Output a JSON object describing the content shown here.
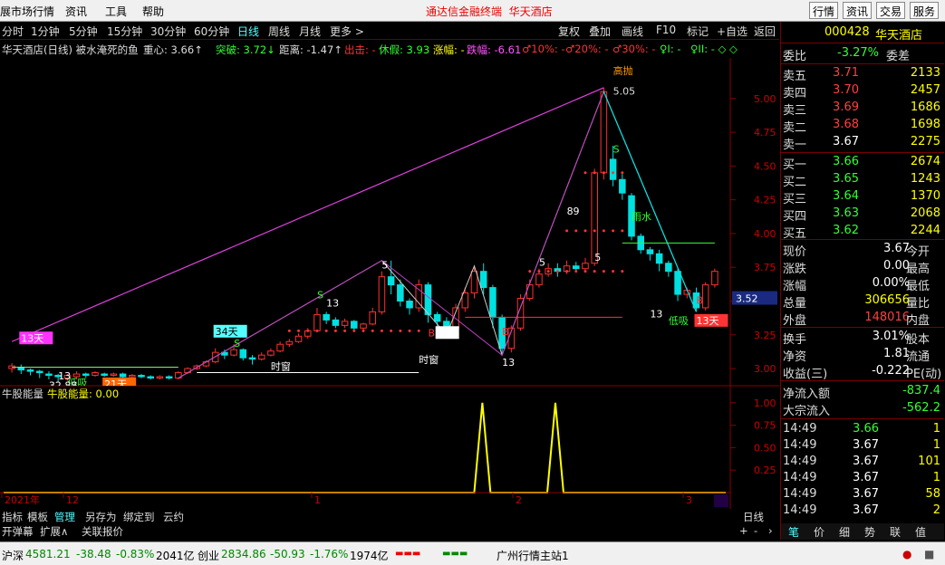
{
  "menu": {
    "items": [
      "展市场行情",
      "资讯",
      "工具",
      "帮助"
    ],
    "title": "通达信金融终端",
    "title_stock": "华天酒店",
    "right_buttons": [
      "行情",
      "资讯",
      "交易",
      "服务"
    ]
  },
  "toolbar": {
    "periods": [
      "分时",
      "1分钟",
      "5分钟",
      "15分钟",
      "30分钟",
      "60分钟",
      "日线",
      "周线",
      "月线",
      "更多 >"
    ],
    "active": "日线",
    "right": [
      "复权",
      "叠加",
      "画线",
      "F10",
      "标记",
      "+自选",
      "返回"
    ]
  },
  "info": {
    "name": "华天酒店(日线) 被水淹死的鱼",
    "center": "重心: 3.66↑",
    "breakout": "突破: 3.72↓",
    "distance": "距离: -1.47↑",
    "exit": "出击: -",
    "rest": "休假: 3.93",
    "rise": "涨幅: -",
    "fall": "跌幅: -6.61",
    "p10": "♂10%: -",
    "p20": "♂20%: -",
    "p30": "♂30%: -",
    "q1": "♀I: -",
    "q2": "♀II: - ◇ ◇"
  },
  "chart_data": {
    "type": "candlestick",
    "ylim": [
      2.9,
      5.3
    ],
    "y_ticks": [
      "5.00",
      "4.75",
      "4.50",
      "4.25",
      "4.00",
      "3.75",
      "3.50",
      "3.25",
      "3.00"
    ],
    "current_price_label": "3.52",
    "high_label": "5.05",
    "annotations": [
      "高抛",
      "13天",
      "34天",
      "21天",
      "低吸",
      "雨水",
      "时窗",
      "时窗",
      "低吸",
      "89",
      "13",
      "13",
      "13",
      "13",
      "13",
      "5",
      "5",
      "5",
      "S",
      "S",
      "S",
      "B",
      "B",
      "B",
      "13天",
      "32.88",
      "用到未来数据",
      "减",
      "榜",
      "跌"
    ],
    "candles": [
      {
        "o": 3.0,
        "c": 3.02,
        "h": 3.04,
        "l": 2.97
      },
      {
        "o": 3.01,
        "c": 2.99,
        "h": 3.03,
        "l": 2.96
      },
      {
        "o": 2.99,
        "c": 2.98,
        "h": 3.0,
        "l": 2.95
      },
      {
        "o": 2.98,
        "c": 2.97,
        "h": 2.99,
        "l": 2.93
      },
      {
        "o": 2.96,
        "c": 2.95,
        "h": 2.98,
        "l": 2.92
      },
      {
        "o": 2.95,
        "c": 2.94,
        "h": 2.96,
        "l": 2.9
      },
      {
        "o": 2.93,
        "c": 2.95,
        "h": 2.96,
        "l": 2.91
      },
      {
        "o": 2.94,
        "c": 2.96,
        "h": 2.98,
        "l": 2.92
      },
      {
        "o": 2.96,
        "c": 2.95,
        "h": 2.97,
        "l": 2.93
      },
      {
        "o": 2.95,
        "c": 2.97,
        "h": 2.98,
        "l": 2.94
      },
      {
        "o": 2.96,
        "c": 2.95,
        "h": 2.97,
        "l": 2.94
      },
      {
        "o": 2.95,
        "c": 2.96,
        "h": 2.97,
        "l": 2.94
      },
      {
        "o": 2.96,
        "c": 2.94,
        "h": 2.97,
        "l": 2.93
      },
      {
        "o": 2.94,
        "c": 2.95,
        "h": 2.96,
        "l": 2.93
      },
      {
        "o": 2.95,
        "c": 2.94,
        "h": 2.96,
        "l": 2.93
      },
      {
        "o": 2.94,
        "c": 2.93,
        "h": 2.95,
        "l": 2.92
      },
      {
        "o": 2.93,
        "c": 2.94,
        "h": 2.95,
        "l": 2.92
      },
      {
        "o": 2.94,
        "c": 2.93,
        "h": 2.95,
        "l": 2.92
      },
      {
        "o": 2.93,
        "c": 2.97,
        "h": 2.98,
        "l": 2.92
      },
      {
        "o": 2.97,
        "c": 3.0,
        "h": 3.01,
        "l": 2.96
      },
      {
        "o": 3.0,
        "c": 3.02,
        "h": 3.03,
        "l": 2.99
      },
      {
        "o": 3.02,
        "c": 3.05,
        "h": 3.06,
        "l": 3.01
      },
      {
        "o": 3.05,
        "c": 3.12,
        "h": 3.15,
        "l": 3.04
      },
      {
        "o": 3.12,
        "c": 3.1,
        "h": 3.14,
        "l": 3.07
      },
      {
        "o": 3.1,
        "c": 3.14,
        "h": 3.18,
        "l": 3.09
      },
      {
        "o": 3.14,
        "c": 3.08,
        "h": 3.15,
        "l": 3.06
      },
      {
        "o": 3.08,
        "c": 3.07,
        "h": 3.1,
        "l": 3.03
      },
      {
        "o": 3.07,
        "c": 3.1,
        "h": 3.12,
        "l": 3.06
      },
      {
        "o": 3.1,
        "c": 3.13,
        "h": 3.15,
        "l": 3.09
      },
      {
        "o": 3.13,
        "c": 3.18,
        "h": 3.2,
        "l": 3.12
      },
      {
        "o": 3.18,
        "c": 3.2,
        "h": 3.22,
        "l": 3.16
      },
      {
        "o": 3.2,
        "c": 3.24,
        "h": 3.26,
        "l": 3.19
      },
      {
        "o": 3.24,
        "c": 3.28,
        "h": 3.3,
        "l": 3.22
      },
      {
        "o": 3.28,
        "c": 3.4,
        "h": 3.45,
        "l": 3.27
      },
      {
        "o": 3.4,
        "c": 3.36,
        "h": 3.42,
        "l": 3.33
      },
      {
        "o": 3.36,
        "c": 3.32,
        "h": 3.38,
        "l": 3.3
      },
      {
        "o": 3.32,
        "c": 3.35,
        "h": 3.37,
        "l": 3.3
      },
      {
        "o": 3.35,
        "c": 3.3,
        "h": 3.36,
        "l": 3.28
      },
      {
        "o": 3.3,
        "c": 3.33,
        "h": 3.34,
        "l": 3.28
      },
      {
        "o": 3.33,
        "c": 3.42,
        "h": 3.45,
        "l": 3.32
      },
      {
        "o": 3.42,
        "c": 3.68,
        "h": 3.72,
        "l": 3.4
      },
      {
        "o": 3.68,
        "c": 3.62,
        "h": 3.8,
        "l": 3.55
      },
      {
        "o": 3.62,
        "c": 3.5,
        "h": 3.66,
        "l": 3.46
      },
      {
        "o": 3.5,
        "c": 3.45,
        "h": 3.52,
        "l": 3.4
      },
      {
        "o": 3.45,
        "c": 3.62,
        "h": 3.66,
        "l": 3.42
      },
      {
        "o": 3.62,
        "c": 3.4,
        "h": 3.64,
        "l": 3.34
      },
      {
        "o": 3.4,
        "c": 3.35,
        "h": 3.42,
        "l": 3.3
      },
      {
        "o": 3.35,
        "c": 3.3,
        "h": 3.38,
        "l": 3.25
      },
      {
        "o": 3.3,
        "c": 3.45,
        "h": 3.48,
        "l": 3.28
      },
      {
        "o": 3.45,
        "c": 3.56,
        "h": 3.6,
        "l": 3.42
      },
      {
        "o": 3.56,
        "c": 3.72,
        "h": 3.76,
        "l": 3.52
      },
      {
        "o": 3.72,
        "c": 3.6,
        "h": 3.78,
        "l": 3.55
      },
      {
        "o": 3.6,
        "c": 3.38,
        "h": 3.62,
        "l": 3.3
      },
      {
        "o": 3.38,
        "c": 3.15,
        "h": 3.4,
        "l": 3.1
      },
      {
        "o": 3.15,
        "c": 3.3,
        "h": 3.32,
        "l": 3.12
      },
      {
        "o": 3.3,
        "c": 3.52,
        "h": 3.55,
        "l": 3.28
      },
      {
        "o": 3.52,
        "c": 3.62,
        "h": 3.66,
        "l": 3.5
      },
      {
        "o": 3.62,
        "c": 3.7,
        "h": 3.74,
        "l": 3.6
      },
      {
        "o": 3.7,
        "c": 3.74,
        "h": 3.78,
        "l": 3.68
      },
      {
        "o": 3.74,
        "c": 3.72,
        "h": 3.78,
        "l": 3.68
      },
      {
        "o": 3.72,
        "c": 3.76,
        "h": 3.8,
        "l": 3.7
      },
      {
        "o": 3.76,
        "c": 3.74,
        "h": 3.79,
        "l": 3.72
      },
      {
        "o": 3.74,
        "c": 3.78,
        "h": 3.82,
        "l": 3.72
      },
      {
        "o": 3.78,
        "c": 4.45,
        "h": 4.48,
        "l": 3.76
      },
      {
        "o": 4.45,
        "c": 5.05,
        "h": 5.08,
        "l": 4.4
      },
      {
        "o": 4.55,
        "c": 4.4,
        "h": 4.65,
        "l": 4.35
      },
      {
        "o": 4.4,
        "c": 4.3,
        "h": 4.44,
        "l": 4.25
      },
      {
        "o": 4.28,
        "c": 3.98,
        "h": 4.3,
        "l": 3.95
      },
      {
        "o": 3.98,
        "c": 3.88,
        "h": 4.0,
        "l": 3.85
      },
      {
        "o": 3.88,
        "c": 3.85,
        "h": 3.9,
        "l": 3.8
      },
      {
        "o": 3.85,
        "c": 3.78,
        "h": 3.88,
        "l": 3.72
      },
      {
        "o": 3.78,
        "c": 3.72,
        "h": 3.8,
        "l": 3.68
      },
      {
        "o": 3.72,
        "c": 3.55,
        "h": 3.74,
        "l": 3.5
      },
      {
        "o": 3.55,
        "c": 3.58,
        "h": 3.6,
        "l": 3.52
      },
      {
        "o": 3.56,
        "c": 3.45,
        "h": 3.6,
        "l": 3.42
      },
      {
        "o": 3.45,
        "c": 3.62,
        "h": 3.64,
        "l": 3.43
      },
      {
        "o": 3.62,
        "c": 3.72,
        "h": 3.74,
        "l": 3.6
      }
    ],
    "sub": {
      "title": "牛股能量",
      "value_label": "牛股能量: 0.00",
      "y_ticks": [
        "1.00",
        "0.75",
        "0.50",
        "0.25"
      ],
      "ylim": [
        0,
        1.15
      ],
      "values": [
        0,
        0,
        0,
        0,
        0,
        0,
        0,
        0,
        0,
        0,
        0,
        0,
        0,
        0,
        0,
        0,
        0,
        0,
        0,
        0,
        0,
        0,
        0,
        0,
        0,
        0,
        0,
        0,
        0,
        0,
        0,
        0,
        0,
        0,
        0,
        0,
        0,
        0,
        0,
        0,
        0,
        0,
        0,
        0,
        0,
        0,
        0,
        0,
        0,
        0,
        0,
        0,
        0,
        0,
        0,
        0,
        0,
        0,
        0,
        1,
        0,
        0,
        0,
        0,
        0,
        0,
        0,
        0,
        1,
        0,
        0,
        0,
        0,
        0,
        0,
        0,
        0,
        0,
        0,
        0,
        0,
        0,
        0,
        0,
        0,
        0,
        0,
        0,
        0,
        0
      ]
    },
    "time_axis": [
      "2021年",
      "12",
      "1",
      "2",
      "3"
    ]
  },
  "quote": {
    "code": "000428",
    "name": "华天酒店",
    "ratio_label": "委比",
    "ratio_value": "-3.27%",
    "diff_label": "委差",
    "asks": [
      {
        "label": "卖五",
        "price": "3.71",
        "vol": "2133"
      },
      {
        "label": "卖四",
        "price": "3.70",
        "vol": "2457"
      },
      {
        "label": "卖三",
        "price": "3.69",
        "vol": "1686"
      },
      {
        "label": "卖二",
        "price": "3.68",
        "vol": "1698"
      },
      {
        "label": "卖一",
        "price": "3.67",
        "vol": "2275"
      }
    ],
    "bids": [
      {
        "label": "买一",
        "price": "3.66",
        "vol": "2674"
      },
      {
        "label": "买二",
        "price": "3.65",
        "vol": "1243"
      },
      {
        "label": "买三",
        "price": "3.64",
        "vol": "1370"
      },
      {
        "label": "买四",
        "price": "3.63",
        "vol": "2068"
      },
      {
        "label": "买五",
        "price": "3.62",
        "vol": "2244"
      }
    ],
    "stats": [
      {
        "l": "现价",
        "v": "3.67",
        "r": "今开",
        "c": "wht"
      },
      {
        "l": "涨跌",
        "v": "0.00",
        "r": "最高",
        "c": "wht"
      },
      {
        "l": "涨幅",
        "v": "0.00%",
        "r": "最低",
        "c": "wht"
      },
      {
        "l": "总量",
        "v": "306656",
        "r": "量比",
        "c": "yel"
      },
      {
        "l": "外盘",
        "v": "148016",
        "r": "内盘",
        "c": "red"
      }
    ],
    "stats2": [
      {
        "l": "换手",
        "v": "3.01%",
        "r": "股本",
        "c": "wht"
      },
      {
        "l": "净资",
        "v": "1.81",
        "r": "流通",
        "c": "wht"
      },
      {
        "l": "收益(三)",
        "v": "-0.222",
        "r": "PE(动)",
        "c": "wht"
      }
    ],
    "flow": [
      {
        "l": "净流入额",
        "v": "-837.4"
      },
      {
        "l": "大宗流入",
        "v": "-562.2"
      }
    ],
    "ticks": [
      {
        "t": "14:49",
        "p": "3.66",
        "v": "1",
        "pc": "grn"
      },
      {
        "t": "14:49",
        "p": "3.67",
        "v": "1",
        "pc": "wht"
      },
      {
        "t": "14:49",
        "p": "3.67",
        "v": "101",
        "pc": "wht"
      },
      {
        "t": "14:49",
        "p": "3.67",
        "v": "1",
        "pc": "wht"
      },
      {
        "t": "14:49",
        "p": "3.67",
        "v": "58",
        "pc": "wht"
      },
      {
        "t": "14:49",
        "p": "3.67",
        "v": "2",
        "pc": "wht"
      }
    ],
    "bottom_tabs": [
      "笔",
      "价",
      "细",
      "势",
      "联",
      "值"
    ]
  },
  "tabs": {
    "row1": [
      "指标",
      "模板",
      "管理",
      "另存为",
      "绑定到",
      "云约"
    ],
    "active": "管理",
    "row2": [
      "开弹幕",
      "扩展∧",
      "关联报价"
    ],
    "period": "日线"
  },
  "status": {
    "sh_label": "沪深",
    "sh_value": "4581.21",
    "sh_change": "-38.48",
    "sh_pct": "-0.83%",
    "sh_amount": "2041亿",
    "cy_label": "创业",
    "cy_value": "2834.86",
    "cy_change": "-50.93",
    "cy_pct": "-1.76%",
    "cy_amount": "1974亿",
    "server": "广州行情主站1"
  }
}
